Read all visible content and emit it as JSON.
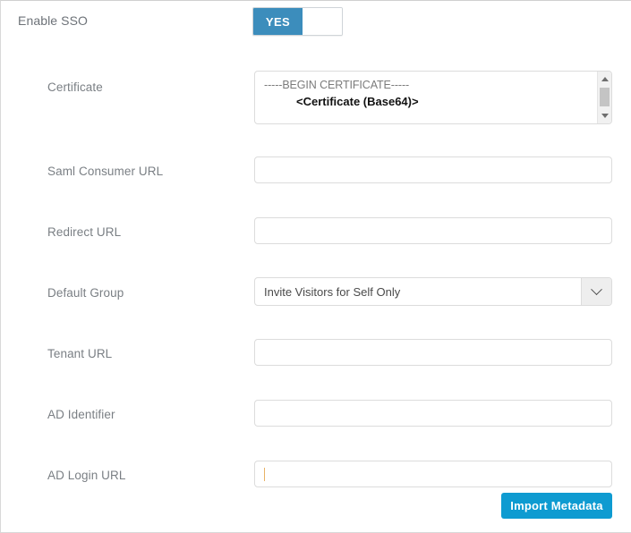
{
  "form": {
    "sso": {
      "label": "Enable SSO",
      "toggle_on_label": "YES",
      "toggle_state": "YES"
    },
    "certificate": {
      "label": "Certificate",
      "line1": "-----BEGIN CERTIFICATE-----",
      "line2": "<Certificate (Base64)>"
    },
    "saml_consumer_url": {
      "label": "Saml Consumer URL",
      "value": "",
      "placeholder": ""
    },
    "redirect_url": {
      "label": "Redirect URL",
      "value": "",
      "placeholder": ""
    },
    "default_group": {
      "label": "Default Group",
      "selected": "Invite Visitors for Self Only",
      "options": [
        "Invite Visitors for Self Only"
      ]
    },
    "tenant_url": {
      "label": "Tenant URL",
      "value": "",
      "placeholder": ""
    },
    "ad_identifier": {
      "label": "AD Identifier",
      "value": "",
      "placeholder": ""
    },
    "ad_login_url": {
      "label": "AD Login URL",
      "value": "",
      "placeholder": "",
      "focused": true
    },
    "import_button": {
      "label": "Import Metadata"
    }
  },
  "colors": {
    "toggle_on": "#3c8dbc",
    "primary_button": "#0e9bd1",
    "label_text": "#7a7f84",
    "border": "#dcdcdc",
    "caret": "#e8b266"
  }
}
